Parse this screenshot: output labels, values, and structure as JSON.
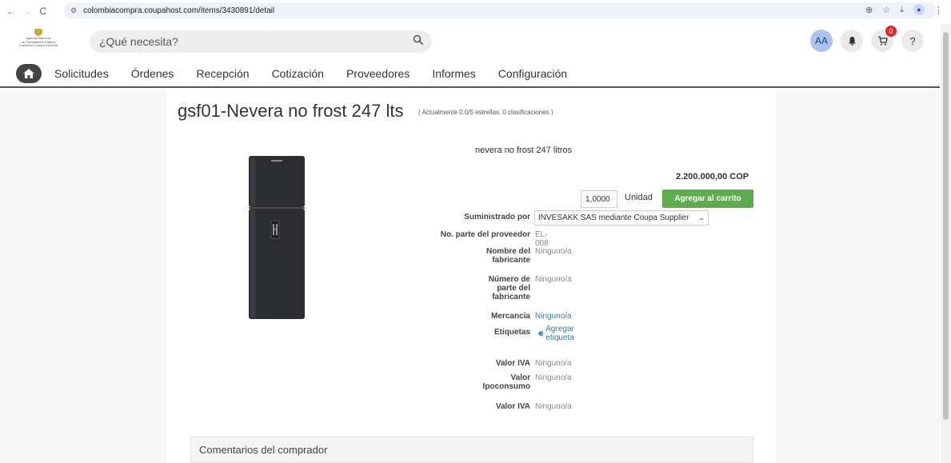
{
  "browser": {
    "url": "colombiacompra.coupahost.com/items/3430891/detail"
  },
  "header": {
    "logo_lines": [
      "Agencia Nacional",
      "de Contratación Pública",
      "Colombia Compra Eficiente"
    ],
    "search_placeholder": "¿Qué necesita?",
    "avatar_initials": "AA",
    "cart_count": "0",
    "help_label": "?"
  },
  "menu": {
    "items": [
      "Solicitudes",
      "Órdenes",
      "Recepción",
      "Cotización",
      "Proveedores",
      "Informes",
      "Configuración"
    ]
  },
  "product": {
    "title": "gsf01-Nevera no frost 247 lts",
    "rating": "( Actualmente 0.0/5 estrellas. 0 clasificaciones )",
    "description": "nevera no frost 247 litros",
    "price": "2.200.000,00 COP",
    "quantity": "1,0000",
    "unit": "Unidad",
    "add_to_cart": "Agregar al carrito"
  },
  "attributes": {
    "supplied_by_label": "Suministrado por",
    "supplied_by_value": "INVESAKK SAS mediante Coupa Supplier",
    "supplier_part_label": "No. parte del proveedor",
    "supplier_part_value": "EL-008",
    "manufacturer_label": "Nombre del fabricante",
    "manufacturer_value": "Ninguno/a",
    "mfr_part_label": "Número de parte del fabricante",
    "mfr_part_value": "Ninguno/a",
    "commodity_label": "Mercancía",
    "commodity_value": "Ninguno/a",
    "tags_label": "Etiquetas",
    "tags_action": "Agregar etiqueta",
    "iva_label": "Valor IVA",
    "iva_value": "Ninguno/a",
    "ipoconsumo_label": "Valor Ipoconsumo",
    "ipoconsumo_value": "Ninguno/a",
    "iva2_label": "Valor IVA",
    "iva2_value": "Ninguno/a"
  },
  "comments": {
    "title": "Comentarios del comprador"
  }
}
